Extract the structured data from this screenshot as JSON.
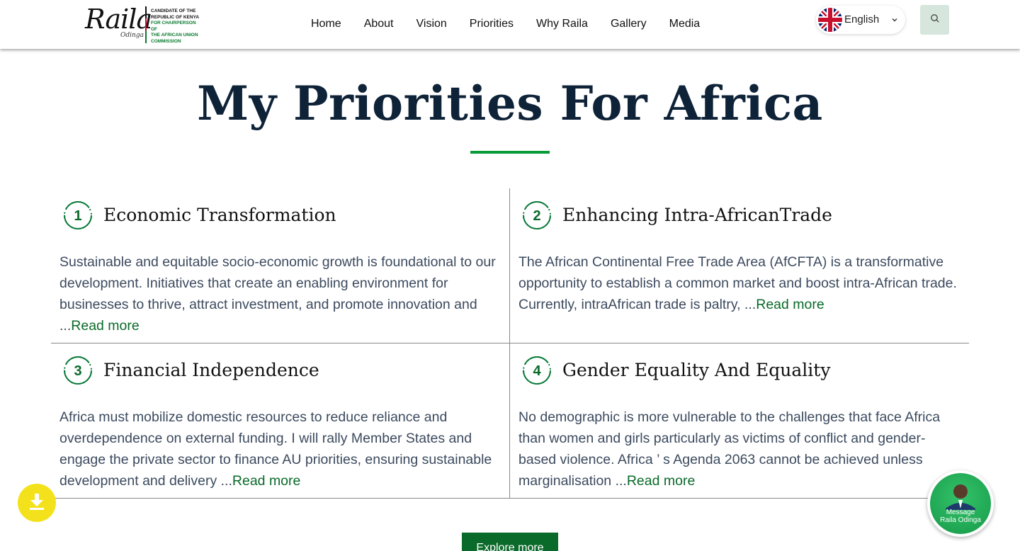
{
  "header": {
    "logo": {
      "script": "Raila",
      "script_sub": "Odinga",
      "lines": [
        "Candidate of the",
        "Republic of Kenya"
      ],
      "green_lines": [
        "For Chairperson of",
        "the African Union",
        "Commission"
      ]
    },
    "nav": [
      "Home",
      "About",
      "Vision",
      "Priorities",
      "Why Raila",
      "Gallery",
      "Media"
    ],
    "language": {
      "label": "English",
      "icon": "uk-flag-icon"
    },
    "search_icon": "search-icon"
  },
  "main": {
    "title": "My Priorities For Africa",
    "accent_color": "#0a9a3a",
    "priorities": [
      {
        "number": "1",
        "title": "Economic Transformation",
        "body": "Sustainable and equitable socio-economic growth is foundational to our development. Initiatives that create an enabling environment for businesses to thrive, attract investment, and promote innovation and ...",
        "link": "Read more"
      },
      {
        "number": "2",
        "title": "Enhancing Intra-AfricanTrade",
        "body": "The African Continental Free Trade Area (AfCFTA) is a transformative opportunity to establish a common market and boost intra-African trade. Currently, intraAfrican trade is paltry, ...",
        "link": "Read more"
      },
      {
        "number": "3",
        "title": "Financial Independence",
        "body": "Africa must mobilize domestic resources to reduce reliance and overdependence on external funding. I will rally Member States and engage the private sector to finance AU priorities, ensuring sustainable development and delivery ...",
        "link": "Read more"
      },
      {
        "number": "4",
        "title": "Gender Equality And Equality",
        "body": "No demographic is more vulnerable to the challenges that face Africa than women and girls particularly as victims of conflict and gender-based violence. Africa ’ s Agenda 2063 cannot be achieved unless marginalisation ...",
        "link": "Read more"
      }
    ],
    "explore_button": "Explore more"
  },
  "floating": {
    "download_icon": "download-icon",
    "message_line1": "Message",
    "message_line2": "Raila Odinga"
  }
}
